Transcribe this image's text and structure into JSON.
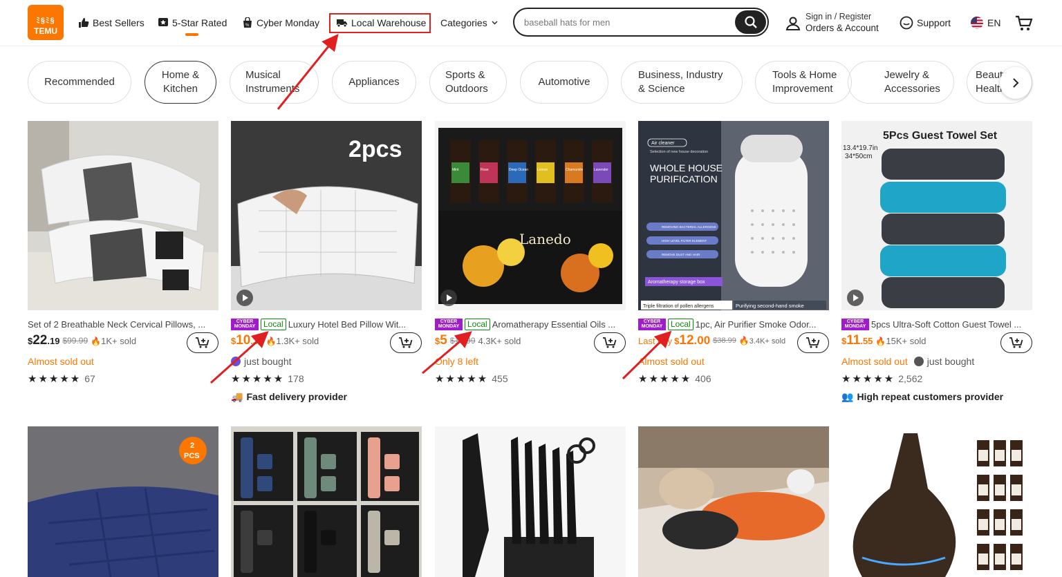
{
  "logo": {
    "line1": "ﾐ§ﾐ§",
    "line2": "TEMU"
  },
  "nav": {
    "best_sellers": "Best Sellers",
    "five_star": "5-Star Rated",
    "cyber_monday": "Cyber Monday",
    "local_warehouse": "Local Warehouse",
    "categories": "Categories"
  },
  "search": {
    "value": "baseball hats for men"
  },
  "account": {
    "line1": "Sign in / Register",
    "line2": "Orders & Account"
  },
  "support": "Support",
  "language": "EN",
  "categories": [
    {
      "label": "Recommended"
    },
    {
      "label": "Home & Kitchen"
    },
    {
      "label": "Musical Instruments"
    },
    {
      "label": "Appliances"
    },
    {
      "label": "Sports & Outdoors"
    },
    {
      "label": "Automotive"
    },
    {
      "label": "Business, Industry & Science"
    },
    {
      "label": "Tools & Home Improvement"
    },
    {
      "label": "Jewelry & Accessories"
    },
    {
      "label": "Beauty & Health"
    }
  ],
  "badges": {
    "cyber": "CYBER",
    "monday": "MONDAY",
    "local": "Local"
  },
  "products": [
    {
      "title": "Set of 2 Breathable Neck Cervical Pillows, ...",
      "price_sym": "$",
      "price_int": "22",
      "price_dec": ".19",
      "orig": "$99.99",
      "sold": "1K+ sold",
      "tag": "Almost sold out",
      "rating_count": "67",
      "provider": ""
    },
    {
      "title": "Luxury Hotel Bed Pillow Wit...",
      "price_sym": "$",
      "price_int": "10",
      "price_dec": ".34",
      "orig": "",
      "sold": "1.3K+ sold",
      "tag": "just bought",
      "rating_count": "178",
      "provider": "Fast delivery provider"
    },
    {
      "title": "Aromatherapy Essential Oils ...",
      "price_sym": "$",
      "price_int": "5",
      "price_dec": "",
      "orig": "$13.99",
      "sold": "4.3K+ sold",
      "tag": "Only 8 left",
      "rating_count": "455",
      "provider": ""
    },
    {
      "title": "1pc, Air Purifier Smoke Odor...",
      "price_prefix": "Last day",
      "price_sym": "$",
      "price_int": "12",
      "price_dec": ".00",
      "orig": "$38.99",
      "sold": "3.4K+ sold",
      "tag": "Almost sold out",
      "rating_count": "406",
      "provider": ""
    },
    {
      "title": "5pcs Ultra-Soft Cotton Guest Towel ...",
      "price_sym": "$",
      "price_int": "11",
      "price_dec": ".55",
      "orig": "",
      "sold": "15K+ sold",
      "tag": "Almost sold out",
      "tag2": "just bought",
      "rating_count": "2,562",
      "provider": "High repeat customers provider"
    }
  ],
  "image_text": {
    "p2": "2pcs",
    "p3_brand": "Lanedo",
    "p4_air": "Air cleaner",
    "p4_sel": "Selection of new house decoration",
    "p4_whole": "WHOLE HOUSE",
    "p4_pur": "PURIFICATION",
    "p4_feat1": "REMOVING BACTERIAL ALLERGENS",
    "p4_feat2": "HIGH LEVEL FILTER ELEMENT",
    "p4_feat3": "REMOVE DUST AND HAIR",
    "p4_aroma": "Aromatherapy storage box",
    "p4_triple": "Triple filtration of pollen allergens",
    "p4_smoke": "Purifying second-hand smoke",
    "p5_title": "5Pcs Guest Towel Set",
    "p5_size1": "13.4*19.7in",
    "p5_size2": "34*50cm",
    "r2_badge1": "2",
    "r2_badge2": "PCS",
    "oil_labels": [
      "Mint",
      "Rose",
      "Deep Ocean",
      "Lemon",
      "Chamomile",
      "Lavender"
    ]
  },
  "colors": {
    "brand": "#fb7701",
    "highlight_red": "#e02020",
    "local_green": "#0a8a0a",
    "cyber_purple": "#a11acd"
  }
}
